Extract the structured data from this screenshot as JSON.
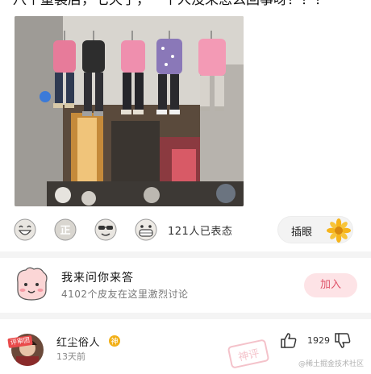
{
  "post": {
    "top_text": "八个童装店，七天了，一个人没来怎么回事呀？？？"
  },
  "reactions": {
    "emojis": [
      "laugh-emoji",
      "zheng-emoji",
      "sunglasses-emoji",
      "grin-emoji"
    ],
    "emoji_zheng_text": "正",
    "count_label": "121人已表态",
    "insert_label": "插眼"
  },
  "qa": {
    "title": "我来问你来答",
    "subtitle": "4102个皮友在这里激烈讨论",
    "join_label": "加入"
  },
  "comment": {
    "badge": "评审团",
    "username": "红尘俗人",
    "verified_char": "神",
    "time": "13天前",
    "like_count": "1929",
    "stamp_text": "神评"
  },
  "watermark": "@稀土掘金技术社区",
  "colors": {
    "accent_pink": "#e0546a",
    "join_bg": "#fde3e6",
    "divider": "#f4f4f4",
    "badge_red": "#e94b4b",
    "verified_gold": "#f2b019"
  }
}
